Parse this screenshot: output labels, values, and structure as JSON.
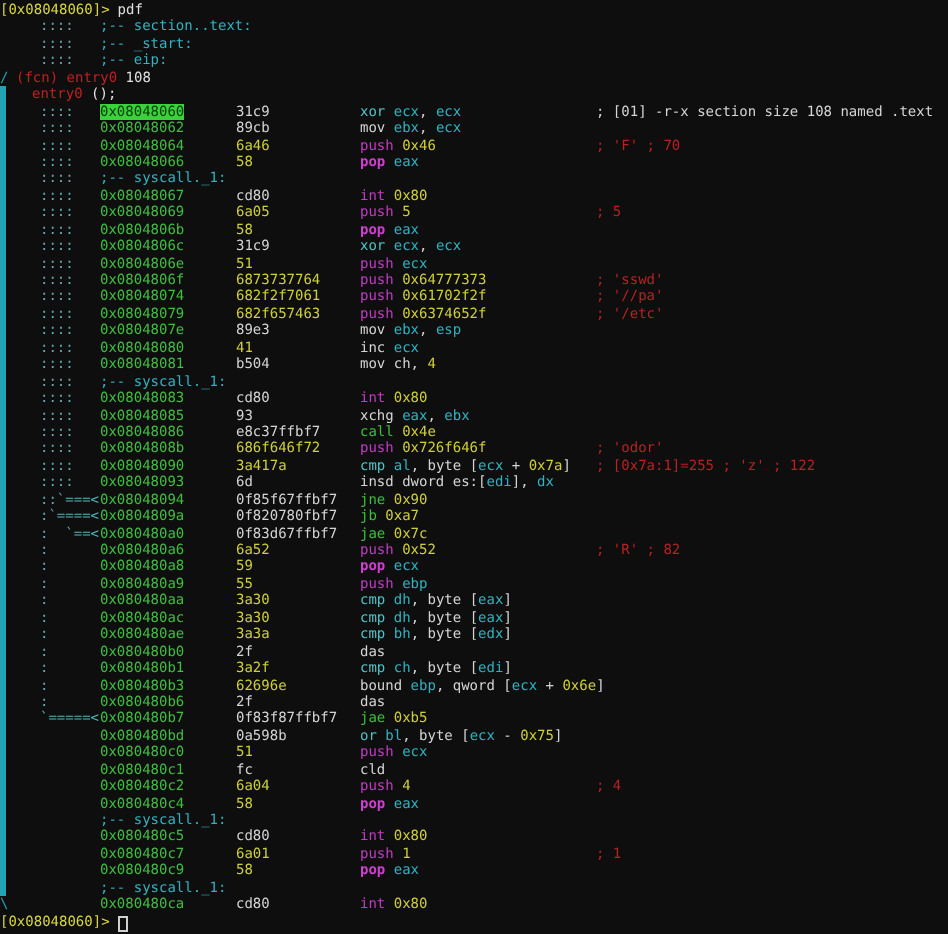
{
  "lines": [
    {
      "kind": "prompt",
      "address": "[0x08048060]>",
      "command": "pdf",
      "cursor": false,
      "in_function": false
    },
    {
      "kind": "label",
      "flow": "::::",
      "text": ";-- section..text:",
      "in_function": false
    },
    {
      "kind": "label",
      "flow": "::::",
      "text": ";-- _start:",
      "in_function": false
    },
    {
      "kind": "label",
      "flow": "::::",
      "text": ";-- eip:",
      "in_function": false
    },
    {
      "kind": "fcn",
      "gutter_mark": "/",
      "tag": "(fcn) entry0",
      "size": "108",
      "in_function": false
    },
    {
      "kind": "entry",
      "name": "entry0",
      "args": "();",
      "in_function": true
    },
    {
      "kind": "instr",
      "in_function": true,
      "flow": "::::",
      "address": "0x08048060",
      "selected": true,
      "bytes": "31c9",
      "printable": false,
      "mnemonic": {
        "text": "xor",
        "kind": "math"
      },
      "operands": [
        {
          "text": "ecx",
          "kind": "register"
        },
        {
          "text": ", ",
          "kind": "plain"
        },
        {
          "text": "ecx",
          "kind": "register"
        }
      ],
      "comment": {
        "text": "; [01] -r-x section size 108 named .text",
        "kind": "info"
      }
    },
    {
      "kind": "instr",
      "in_function": true,
      "flow": "::::",
      "address": "0x08048062",
      "selected": false,
      "bytes": "89cb",
      "printable": false,
      "mnemonic": {
        "text": "mov",
        "kind": "plain"
      },
      "operands": [
        {
          "text": "ebx",
          "kind": "register"
        },
        {
          "text": ", ",
          "kind": "plain"
        },
        {
          "text": "ecx",
          "kind": "register"
        }
      ]
    },
    {
      "kind": "instr",
      "in_function": true,
      "flow": "::::",
      "address": "0x08048064",
      "selected": false,
      "bytes": "6a46",
      "printable": true,
      "mnemonic": {
        "text": "push",
        "kind": "stack"
      },
      "operands": [
        {
          "text": "0x46",
          "kind": "number"
        }
      ],
      "comment": {
        "text": "; 'F' ; 70",
        "kind": "value"
      }
    },
    {
      "kind": "instr",
      "in_function": true,
      "flow": "::::",
      "address": "0x08048066",
      "selected": false,
      "bytes": "58",
      "printable": true,
      "mnemonic": {
        "text": "pop",
        "kind": "pop"
      },
      "operands": [
        {
          "text": "eax",
          "kind": "register"
        }
      ]
    },
    {
      "kind": "label",
      "flow": "::::",
      "text": ";-- syscall._1:",
      "in_function": true
    },
    {
      "kind": "instr",
      "in_function": true,
      "flow": "::::",
      "address": "0x08048067",
      "selected": false,
      "bytes": "cd80",
      "printable": false,
      "mnemonic": {
        "text": "int",
        "kind": "trap"
      },
      "operands": [
        {
          "text": "0x80",
          "kind": "number"
        }
      ]
    },
    {
      "kind": "instr",
      "in_function": true,
      "flow": "::::",
      "address": "0x08048069",
      "selected": false,
      "bytes": "6a05",
      "printable": true,
      "mnemonic": {
        "text": "push",
        "kind": "stack"
      },
      "operands": [
        {
          "text": "5",
          "kind": "number"
        }
      ],
      "comment": {
        "text": "; 5",
        "kind": "value"
      }
    },
    {
      "kind": "instr",
      "in_function": true,
      "flow": "::::",
      "address": "0x0804806b",
      "selected": false,
      "bytes": "58",
      "printable": true,
      "mnemonic": {
        "text": "pop",
        "kind": "pop"
      },
      "operands": [
        {
          "text": "eax",
          "kind": "register"
        }
      ]
    },
    {
      "kind": "instr",
      "in_function": true,
      "flow": "::::",
      "address": "0x0804806c",
      "selected": false,
      "bytes": "31c9",
      "printable": false,
      "mnemonic": {
        "text": "xor",
        "kind": "math"
      },
      "operands": [
        {
          "text": "ecx",
          "kind": "register"
        },
        {
          "text": ", ",
          "kind": "plain"
        },
        {
          "text": "ecx",
          "kind": "register"
        }
      ]
    },
    {
      "kind": "instr",
      "in_function": true,
      "flow": "::::",
      "address": "0x0804806e",
      "selected": false,
      "bytes": "51",
      "printable": true,
      "mnemonic": {
        "text": "push",
        "kind": "stack"
      },
      "operands": [
        {
          "text": "ecx",
          "kind": "register"
        }
      ]
    },
    {
      "kind": "instr",
      "in_function": true,
      "flow": "::::",
      "address": "0x0804806f",
      "selected": false,
      "bytes": "6873737764",
      "printable": true,
      "mnemonic": {
        "text": "push",
        "kind": "stack"
      },
      "operands": [
        {
          "text": "0x64777373",
          "kind": "number"
        }
      ],
      "comment": {
        "text": "; 'sswd'",
        "kind": "value"
      }
    },
    {
      "kind": "instr",
      "in_function": true,
      "flow": "::::",
      "address": "0x08048074",
      "selected": false,
      "bytes": "682f2f7061",
      "printable": true,
      "mnemonic": {
        "text": "push",
        "kind": "stack"
      },
      "operands": [
        {
          "text": "0x61702f2f",
          "kind": "number"
        }
      ],
      "comment": {
        "text": "; '//pa'",
        "kind": "value"
      }
    },
    {
      "kind": "instr",
      "in_function": true,
      "flow": "::::",
      "address": "0x08048079",
      "selected": false,
      "bytes": "682f657463",
      "printable": true,
      "mnemonic": {
        "text": "push",
        "kind": "stack"
      },
      "operands": [
        {
          "text": "0x6374652f",
          "kind": "number"
        }
      ],
      "comment": {
        "text": "; '/etc'",
        "kind": "value"
      }
    },
    {
      "kind": "instr",
      "in_function": true,
      "flow": "::::",
      "address": "0x0804807e",
      "selected": false,
      "bytes": "89e3",
      "printable": false,
      "mnemonic": {
        "text": "mov",
        "kind": "plain"
      },
      "operands": [
        {
          "text": "ebx",
          "kind": "register"
        },
        {
          "text": ", ",
          "kind": "plain"
        },
        {
          "text": "esp",
          "kind": "register"
        }
      ]
    },
    {
      "kind": "instr",
      "in_function": true,
      "flow": "::::",
      "address": "0x08048080",
      "selected": false,
      "bytes": "41",
      "printable": true,
      "mnemonic": {
        "text": "inc",
        "kind": "plain"
      },
      "operands": [
        {
          "text": "ecx",
          "kind": "register"
        }
      ]
    },
    {
      "kind": "instr",
      "in_function": true,
      "flow": "::::",
      "address": "0x08048081",
      "selected": false,
      "bytes": "b504",
      "printable": false,
      "mnemonic": {
        "text": "mov",
        "kind": "plain"
      },
      "operands": [
        {
          "text": "ch, ",
          "kind": "plain"
        },
        {
          "text": "4",
          "kind": "number"
        }
      ]
    },
    {
      "kind": "label",
      "flow": "::::",
      "text": ";-- syscall._1:",
      "in_function": true
    },
    {
      "kind": "instr",
      "in_function": true,
      "flow": "::::",
      "address": "0x08048083",
      "selected": false,
      "bytes": "cd80",
      "printable": false,
      "mnemonic": {
        "text": "int",
        "kind": "trap"
      },
      "operands": [
        {
          "text": "0x80",
          "kind": "number"
        }
      ]
    },
    {
      "kind": "instr",
      "in_function": true,
      "flow": "::::",
      "address": "0x08048085",
      "selected": false,
      "bytes": "93",
      "printable": false,
      "mnemonic": {
        "text": "xchg",
        "kind": "plain"
      },
      "operands": [
        {
          "text": "eax",
          "kind": "register"
        },
        {
          "text": ", ",
          "kind": "plain"
        },
        {
          "text": "ebx",
          "kind": "register"
        }
      ]
    },
    {
      "kind": "instr",
      "in_function": true,
      "flow": "::::",
      "address": "0x08048086",
      "selected": false,
      "bytes": "e8c37ffbf7",
      "printable": false,
      "mnemonic": {
        "text": "call",
        "kind": "branch"
      },
      "operands": [
        {
          "text": "0x4e",
          "kind": "number"
        }
      ]
    },
    {
      "kind": "instr",
      "in_function": true,
      "flow": "::::",
      "address": "0x0804808b",
      "selected": false,
      "bytes": "686f646f72",
      "printable": true,
      "mnemonic": {
        "text": "push",
        "kind": "stack"
      },
      "operands": [
        {
          "text": "0x726f646f",
          "kind": "number"
        }
      ],
      "comment": {
        "text": "; 'odor'",
        "kind": "value"
      }
    },
    {
      "kind": "instr",
      "in_function": true,
      "flow": "::::",
      "address": "0x08048090",
      "selected": false,
      "bytes": "3a417a",
      "printable": true,
      "mnemonic": {
        "text": "cmp",
        "kind": "math"
      },
      "operands": [
        {
          "text": "al",
          "kind": "register"
        },
        {
          "text": ", byte [",
          "kind": "plain"
        },
        {
          "text": "ecx",
          "kind": "register"
        },
        {
          "text": " + ",
          "kind": "plain"
        },
        {
          "text": "0x7a",
          "kind": "number"
        },
        {
          "text": "]",
          "kind": "plain"
        }
      ],
      "comment": {
        "text": "; [0x7a:1]=255 ; 'z' ; 122",
        "kind": "value"
      }
    },
    {
      "kind": "instr",
      "in_function": true,
      "flow": "::::",
      "address": "0x08048093",
      "selected": false,
      "bytes": "6d",
      "printable": false,
      "mnemonic": {
        "text": "insd",
        "kind": "plain"
      },
      "operands": [
        {
          "text": "dword es:[",
          "kind": "plain"
        },
        {
          "text": "edi",
          "kind": "register"
        },
        {
          "text": "], ",
          "kind": "plain"
        },
        {
          "text": "dx",
          "kind": "register"
        }
      ]
    },
    {
      "kind": "instr",
      "in_function": true,
      "flow": "::`===<",
      "address": "0x08048094",
      "selected": false,
      "bytes": "0f85f67ffbf7",
      "printable": false,
      "mnemonic": {
        "text": "jne",
        "kind": "branch"
      },
      "operands": [
        {
          "text": "0x90",
          "kind": "number"
        }
      ]
    },
    {
      "kind": "instr",
      "in_function": true,
      "flow": ":`====<",
      "address": "0x0804809a",
      "selected": false,
      "bytes": "0f820780fbf7",
      "printable": false,
      "mnemonic": {
        "text": "jb",
        "kind": "branch"
      },
      "operands": [
        {
          "text": "0xa7",
          "kind": "number"
        }
      ]
    },
    {
      "kind": "instr",
      "in_function": true,
      "flow": ":  `==<",
      "address": "0x080480a0",
      "selected": false,
      "bytes": "0f83d67ffbf7",
      "printable": false,
      "mnemonic": {
        "text": "jae",
        "kind": "branch"
      },
      "operands": [
        {
          "text": "0x7c",
          "kind": "number"
        }
      ]
    },
    {
      "kind": "instr",
      "in_function": true,
      "flow": ":",
      "address": "0x080480a6",
      "selected": false,
      "bytes": "6a52",
      "printable": true,
      "mnemonic": {
        "text": "push",
        "kind": "stack"
      },
      "operands": [
        {
          "text": "0x52",
          "kind": "number"
        }
      ],
      "comment": {
        "text": "; 'R' ; 82",
        "kind": "value"
      }
    },
    {
      "kind": "instr",
      "in_function": true,
      "flow": ":",
      "address": "0x080480a8",
      "selected": false,
      "bytes": "59",
      "printable": true,
      "mnemonic": {
        "text": "pop",
        "kind": "pop"
      },
      "operands": [
        {
          "text": "ecx",
          "kind": "register"
        }
      ]
    },
    {
      "kind": "instr",
      "in_function": true,
      "flow": ":",
      "address": "0x080480a9",
      "selected": false,
      "bytes": "55",
      "printable": true,
      "mnemonic": {
        "text": "push",
        "kind": "stack"
      },
      "operands": [
        {
          "text": "ebp",
          "kind": "register"
        }
      ]
    },
    {
      "kind": "instr",
      "in_function": true,
      "flow": ":",
      "address": "0x080480aa",
      "selected": false,
      "bytes": "3a30",
      "printable": true,
      "mnemonic": {
        "text": "cmp",
        "kind": "math"
      },
      "operands": [
        {
          "text": "dh",
          "kind": "register"
        },
        {
          "text": ", byte [",
          "kind": "plain"
        },
        {
          "text": "eax",
          "kind": "register"
        },
        {
          "text": "]",
          "kind": "plain"
        }
      ]
    },
    {
      "kind": "instr",
      "in_function": true,
      "flow": ":",
      "address": "0x080480ac",
      "selected": false,
      "bytes": "3a30",
      "printable": true,
      "mnemonic": {
        "text": "cmp",
        "kind": "math"
      },
      "operands": [
        {
          "text": "dh",
          "kind": "register"
        },
        {
          "text": ", byte [",
          "kind": "plain"
        },
        {
          "text": "eax",
          "kind": "register"
        },
        {
          "text": "]",
          "kind": "plain"
        }
      ]
    },
    {
      "kind": "instr",
      "in_function": true,
      "flow": ":",
      "address": "0x080480ae",
      "selected": false,
      "bytes": "3a3a",
      "printable": true,
      "mnemonic": {
        "text": "cmp",
        "kind": "math"
      },
      "operands": [
        {
          "text": "bh",
          "kind": "register"
        },
        {
          "text": ", byte [",
          "kind": "plain"
        },
        {
          "text": "edx",
          "kind": "register"
        },
        {
          "text": "]",
          "kind": "plain"
        }
      ]
    },
    {
      "kind": "instr",
      "in_function": true,
      "flow": ":",
      "address": "0x080480b0",
      "selected": false,
      "bytes": "2f",
      "printable": false,
      "mnemonic": {
        "text": "das",
        "kind": "plain"
      }
    },
    {
      "kind": "instr",
      "in_function": true,
      "flow": ":",
      "address": "0x080480b1",
      "selected": false,
      "bytes": "3a2f",
      "printable": true,
      "mnemonic": {
        "text": "cmp",
        "kind": "math"
      },
      "operands": [
        {
          "text": "ch",
          "kind": "register"
        },
        {
          "text": ", byte [",
          "kind": "plain"
        },
        {
          "text": "edi",
          "kind": "register"
        },
        {
          "text": "]",
          "kind": "plain"
        }
      ]
    },
    {
      "kind": "instr",
      "in_function": true,
      "flow": ":",
      "address": "0x080480b3",
      "selected": false,
      "bytes": "62696e",
      "printable": true,
      "mnemonic": {
        "text": "bound",
        "kind": "plain"
      },
      "operands": [
        {
          "text": "ebp",
          "kind": "register"
        },
        {
          "text": ", qword [",
          "kind": "plain"
        },
        {
          "text": "ecx",
          "kind": "register"
        },
        {
          "text": " + ",
          "kind": "plain"
        },
        {
          "text": "0x6e",
          "kind": "number"
        },
        {
          "text": "]",
          "kind": "plain"
        }
      ]
    },
    {
      "kind": "instr",
      "in_function": true,
      "flow": ":",
      "address": "0x080480b6",
      "selected": false,
      "bytes": "2f",
      "printable": false,
      "mnemonic": {
        "text": "das",
        "kind": "plain"
      }
    },
    {
      "kind": "instr",
      "in_function": true,
      "flow": "`=====<",
      "address": "0x080480b7",
      "selected": false,
      "bytes": "0f83f87ffbf7",
      "printable": false,
      "mnemonic": {
        "text": "jae",
        "kind": "branch"
      },
      "operands": [
        {
          "text": "0xb5",
          "kind": "number"
        }
      ]
    },
    {
      "kind": "instr",
      "in_function": true,
      "address": "0x080480bd",
      "selected": false,
      "bytes": "0a598b",
      "printable": false,
      "mnemonic": {
        "text": "or",
        "kind": "math"
      },
      "operands": [
        {
          "text": "bl",
          "kind": "register"
        },
        {
          "text": ", byte [",
          "kind": "plain"
        },
        {
          "text": "ecx",
          "kind": "register"
        },
        {
          "text": " - ",
          "kind": "plain"
        },
        {
          "text": "0x75",
          "kind": "number"
        },
        {
          "text": "]",
          "kind": "plain"
        }
      ]
    },
    {
      "kind": "instr",
      "in_function": true,
      "address": "0x080480c0",
      "selected": false,
      "bytes": "51",
      "printable": true,
      "mnemonic": {
        "text": "push",
        "kind": "stack"
      },
      "operands": [
        {
          "text": "ecx",
          "kind": "register"
        }
      ]
    },
    {
      "kind": "instr",
      "in_function": true,
      "address": "0x080480c1",
      "selected": false,
      "bytes": "fc",
      "printable": false,
      "mnemonic": {
        "text": "cld",
        "kind": "plain"
      }
    },
    {
      "kind": "instr",
      "in_function": true,
      "address": "0x080480c2",
      "selected": false,
      "bytes": "6a04",
      "printable": true,
      "mnemonic": {
        "text": "push",
        "kind": "stack"
      },
      "operands": [
        {
          "text": "4",
          "kind": "number"
        }
      ],
      "comment": {
        "text": "; 4",
        "kind": "value"
      }
    },
    {
      "kind": "instr",
      "in_function": true,
      "address": "0x080480c4",
      "selected": false,
      "bytes": "58",
      "printable": true,
      "mnemonic": {
        "text": "pop",
        "kind": "pop"
      },
      "operands": [
        {
          "text": "eax",
          "kind": "register"
        }
      ]
    },
    {
      "kind": "label",
      "text": ";-- syscall._1:",
      "in_function": true
    },
    {
      "kind": "instr",
      "in_function": true,
      "address": "0x080480c5",
      "selected": false,
      "bytes": "cd80",
      "printable": false,
      "mnemonic": {
        "text": "int",
        "kind": "trap"
      },
      "operands": [
        {
          "text": "0x80",
          "kind": "number"
        }
      ]
    },
    {
      "kind": "instr",
      "in_function": true,
      "address": "0x080480c7",
      "selected": false,
      "bytes": "6a01",
      "printable": true,
      "mnemonic": {
        "text": "push",
        "kind": "stack"
      },
      "operands": [
        {
          "text": "1",
          "kind": "number"
        }
      ],
      "comment": {
        "text": "; 1",
        "kind": "value"
      }
    },
    {
      "kind": "instr",
      "in_function": true,
      "address": "0x080480c9",
      "selected": false,
      "bytes": "58",
      "printable": true,
      "mnemonic": {
        "text": "pop",
        "kind": "pop"
      },
      "operands": [
        {
          "text": "eax",
          "kind": "register"
        }
      ]
    },
    {
      "kind": "label",
      "text": ";-- syscall._1:",
      "in_function": true
    },
    {
      "kind": "instr",
      "in_function": false,
      "gutter_mark": "\\",
      "address": "0x080480ca",
      "selected": false,
      "bytes": "cd80",
      "printable": false,
      "mnemonic": {
        "text": "int",
        "kind": "trap"
      },
      "operands": [
        {
          "text": "0x80",
          "kind": "number"
        }
      ]
    },
    {
      "kind": "prompt",
      "address": "[0x08048060]>",
      "cursor": true,
      "in_function": false
    }
  ]
}
